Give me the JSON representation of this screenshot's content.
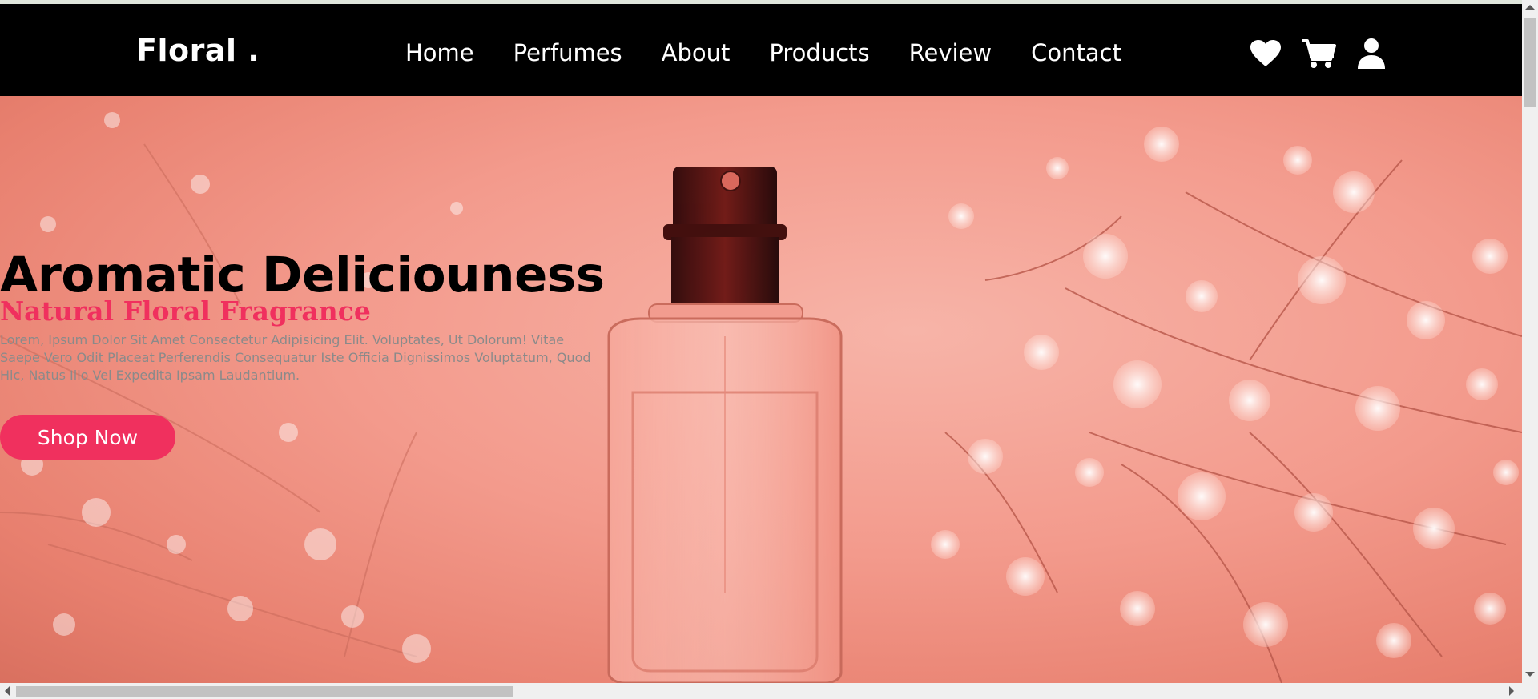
{
  "brand": {
    "logo_text": "Floral ."
  },
  "nav": {
    "links": [
      {
        "label": "Home"
      },
      {
        "label": "Perfumes"
      },
      {
        "label": "About"
      },
      {
        "label": "Products"
      },
      {
        "label": "Review"
      },
      {
        "label": "Contact"
      }
    ],
    "icons": [
      "heart-icon",
      "cart-icon",
      "user-icon"
    ]
  },
  "hero": {
    "title": "Aromatic Deliciouness",
    "subtitle": "Natural Floral Fragrance",
    "description": "Lorem, Ipsum Dolor Sit Amet Consectetur Adipisicing Elit. Voluptates, Ut Dolorum! Vitae Saepe Vero Odit Placeat Perferendis Consequatur Iste Officia Dignissimos Voluptatum, Quod Hic, Natus Illo Vel Expedita Ipsam Laudantium.",
    "cta_label": "Shop Now"
  },
  "colors": {
    "navbar_bg": "#000000",
    "accent": "#f0305e",
    "hero_bg": "#f39a8c",
    "description_text": "#8a8a8a"
  }
}
